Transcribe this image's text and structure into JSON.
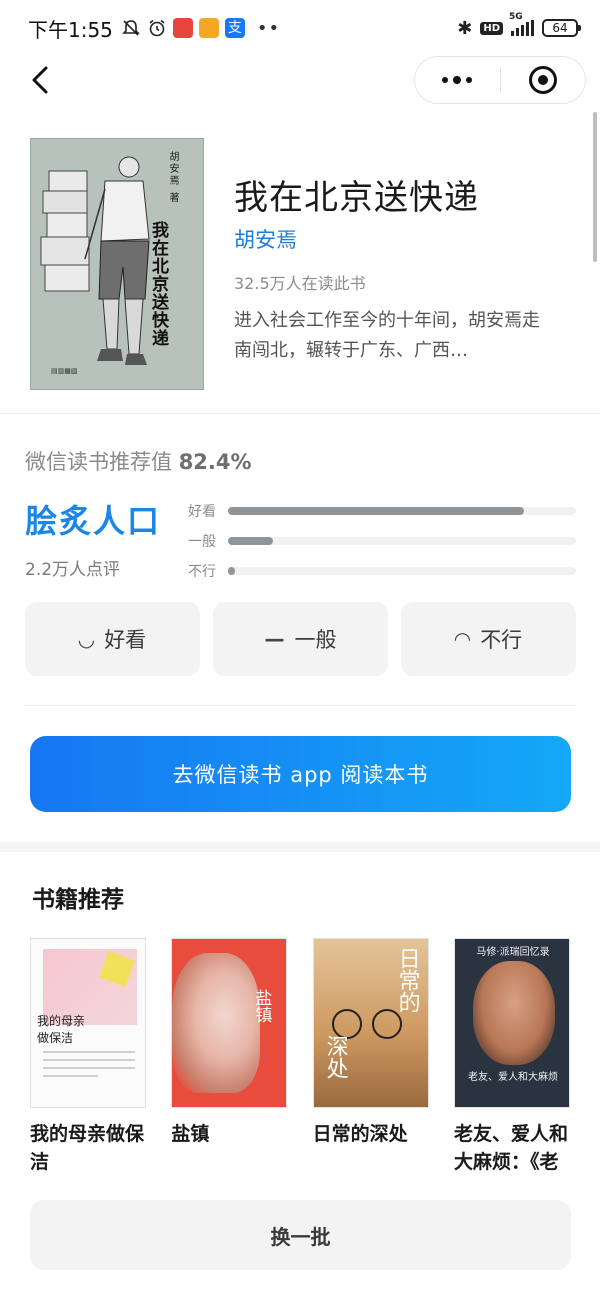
{
  "status_bar": {
    "time": "下午1:55",
    "app_icon_3_glyph": "支",
    "network": "5G",
    "hd": "HD",
    "battery": "64"
  },
  "book": {
    "cover_author": "胡安焉 著",
    "cover_title": "我在北京送快递",
    "title": "我在北京送快递",
    "author": "胡安焉",
    "readers": "32.5万人在读此书",
    "description": "进入社会工作至今的十年间，胡安焉走南闯北，辗转于广东、广西…"
  },
  "rating": {
    "label": "微信读书推荐值",
    "value": "82.4%",
    "word": "脍炙人口",
    "review_count": "2.2万人点评",
    "bars": [
      {
        "label": "好看",
        "level": 0.85
      },
      {
        "label": "一般",
        "level": 0.13
      },
      {
        "label": "不行",
        "level": 0.02
      }
    ],
    "buttons": [
      {
        "label": "好看",
        "face": "◡"
      },
      {
        "label": "一般",
        "face": "—"
      },
      {
        "label": "不行",
        "face": "◠"
      }
    ]
  },
  "read_button": "去微信读书 app 阅读本书",
  "recommend": {
    "title": "书籍推荐",
    "books": [
      {
        "name": "我的母亲做保洁",
        "cover_text": "我的母亲\n做保洁"
      },
      {
        "name": "盐镇",
        "cover_text": "盐镇"
      },
      {
        "name": "日常的深处",
        "cover_text": "日常的",
        "cover_text_2": "深处"
      },
      {
        "name": "老友、爱人和大麻烦：《老",
        "cover_text": "马修·派瑞回忆录",
        "cover_text_2": "老友、爱人和大麻烦"
      }
    ],
    "swap_button": "换一批"
  },
  "colors": {
    "accent": "#1d7de0",
    "rating_word": "#1a86e8",
    "button_gradient_start": "#1677f2",
    "button_gradient_end": "#14a8f7"
  }
}
